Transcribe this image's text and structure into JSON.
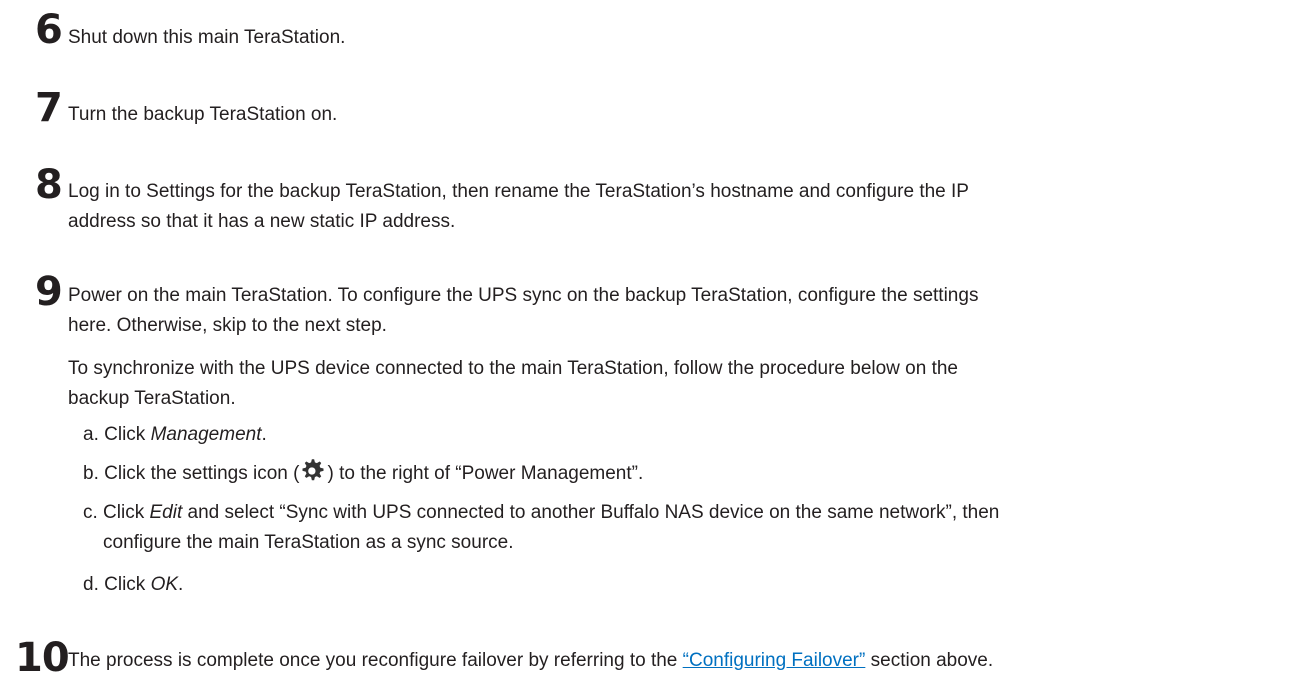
{
  "steps": {
    "s6": {
      "num": "6",
      "text": "Shut down this main TeraStation."
    },
    "s7": {
      "num": "7",
      "text": "Turn the backup TeraStation on."
    },
    "s8": {
      "num": "8",
      "line1": "Log in to Settings for the backup TeraStation, then rename the TeraStation’s hostname and configure the IP",
      "line2": "address so that it has a new static IP address."
    },
    "s9": {
      "num": "9",
      "line1": "Power on the main TeraStation. To configure the UPS sync on the backup TeraStation, configure the settings",
      "line2": "here. Otherwise, skip to the next step.",
      "para1": "To synchronize with the UPS device connected to the main TeraStation, follow the procedure below on the",
      "para2": "backup TeraStation.",
      "a_prefix": "a.  Click ",
      "a_em": "Management",
      "a_suffix": ".",
      "b_prefix": "b.  Click the settings icon (",
      "b_suffix": ") to the right of “Power Management”.",
      "c_prefix": "c.  Click ",
      "c_em": "Edit",
      "c_suffix": " and select “Sync with UPS connected to another Buffalo NAS device on the same network”, then",
      "c_line2": "configure the main TeraStation as a sync source.",
      "d_prefix": "d.  Click ",
      "d_em": "OK",
      "d_suffix": "."
    },
    "s10": {
      "num": "10",
      "prefix": "The process is complete once you reconfigure failover by referring to the ",
      "link": "“Configuring Failover”",
      "suffix": " section above."
    }
  },
  "icons": {
    "settings": "gear-icon"
  },
  "colors": {
    "text": "#231f20",
    "link": "#0070c0",
    "gear": "#333333"
  }
}
